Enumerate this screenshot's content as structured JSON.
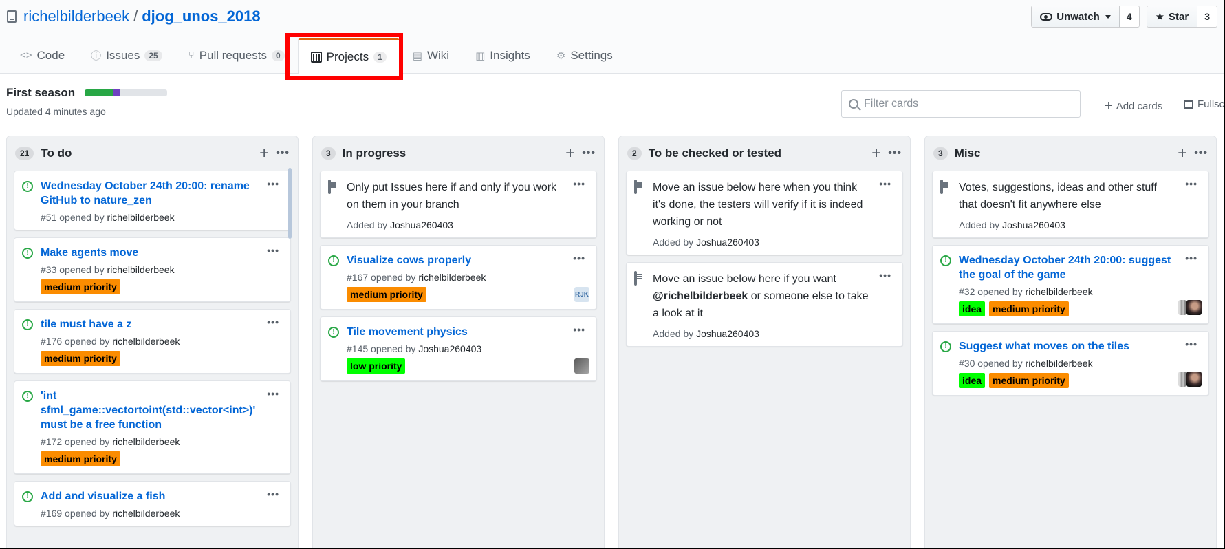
{
  "repo": {
    "owner": "richelbilderbeek",
    "separator": "/",
    "name": "djog_unos_2018"
  },
  "actions": {
    "watch": {
      "label": "Unwatch",
      "count": "4"
    },
    "star": {
      "label": "Star",
      "count": "3"
    }
  },
  "nav": {
    "code": {
      "label": "Code"
    },
    "issues": {
      "label": "Issues",
      "count": "25"
    },
    "pulls": {
      "label": "Pull requests",
      "count": "0"
    },
    "projects": {
      "label": "Projects",
      "count": "1"
    },
    "wiki": {
      "label": "Wiki"
    },
    "insights": {
      "label": "Insights"
    },
    "settings": {
      "label": "Settings"
    }
  },
  "project": {
    "name": "First season",
    "updated": "Updated 4 minutes ago",
    "progress": {
      "done_pct": 35,
      "in_progress_pct": 8
    },
    "filter_placeholder": "Filter cards",
    "add_cards": "Add cards",
    "fullscreen": "Fullscreen"
  },
  "columns": [
    {
      "count": "21",
      "title": "To do",
      "cards": [
        {
          "type": "issue",
          "title": "Wednesday October 24th 20:00: rename GitHub to nature_zen",
          "meta": "#51 opened by",
          "author": "richelbilderbeek",
          "labels": []
        },
        {
          "type": "issue",
          "title": "Make agents move",
          "meta": "#33 opened by",
          "author": "richelbilderbeek",
          "labels": [
            "medium priority"
          ]
        },
        {
          "type": "issue",
          "title": "tile must have a z",
          "meta": "#176 opened by",
          "author": "richelbilderbeek",
          "labels": [
            "medium priority"
          ]
        },
        {
          "type": "issue",
          "title": "'int sfml_game::vectortoint(std::vector<int>)' must be a free function",
          "meta": "#172 opened by",
          "author": "richelbilderbeek",
          "labels": [
            "medium priority"
          ]
        },
        {
          "type": "issue",
          "title": "Add and visualize a fish",
          "meta": "#169 opened by",
          "author": "richelbilderbeek",
          "labels": []
        }
      ]
    },
    {
      "count": "3",
      "title": "In progress",
      "cards": [
        {
          "type": "note",
          "text": "Only put Issues here if and only if you work on them in your branch",
          "added": "Added by",
          "author": "Joshua260403"
        },
        {
          "type": "issue",
          "title": "Visualize cows properly",
          "meta": "#167 opened by",
          "author": "richelbilderbeek",
          "labels": [
            "medium priority"
          ],
          "avatar": "RJK"
        },
        {
          "type": "issue",
          "title": "Tile movement physics",
          "meta": "#145 opened by",
          "author": "Joshua260403",
          "labels": [
            "low priority"
          ],
          "avatar": "gray"
        }
      ]
    },
    {
      "count": "2",
      "title": "To be checked or tested",
      "cards": [
        {
          "type": "note",
          "text": "Move an issue below here when you think it's done, the testers will verify if it is indeed working or not",
          "added": "Added by",
          "author": "Joshua260403"
        },
        {
          "type": "note",
          "text_pre": "Move an issue below here if you want",
          "mention": "@richelbilderbeek",
          "text_post": "or someone else to take a look at it",
          "added": "Added by",
          "author": "Joshua260403"
        }
      ]
    },
    {
      "count": "3",
      "title": "Misc",
      "cards": [
        {
          "type": "note",
          "text": "Votes, suggestions, ideas and other stuff that doesn't fit anywhere else",
          "added": "Added by",
          "author": "Joshua260403"
        },
        {
          "type": "issue",
          "title": "Wednesday October 24th 20:00: suggest the goal of the game",
          "meta": "#32 opened by",
          "author": "richelbilderbeek",
          "labels": [
            "idea",
            "medium priority"
          ],
          "avatar": "duo"
        },
        {
          "type": "issue",
          "title": "Suggest what moves on the tiles",
          "meta": "#30 opened by",
          "author": "richelbilderbeek",
          "labels": [
            "idea",
            "medium priority"
          ],
          "avatar": "duo"
        }
      ]
    }
  ],
  "label_colors": {
    "medium priority": "#fb8c00",
    "low priority": "#00ff00",
    "idea": "#00ff00"
  },
  "colors": {
    "link": "#0366d6",
    "selected_tab_accent": "#e36209",
    "highlight": "#ff0000",
    "issue_open": "#28a745"
  }
}
